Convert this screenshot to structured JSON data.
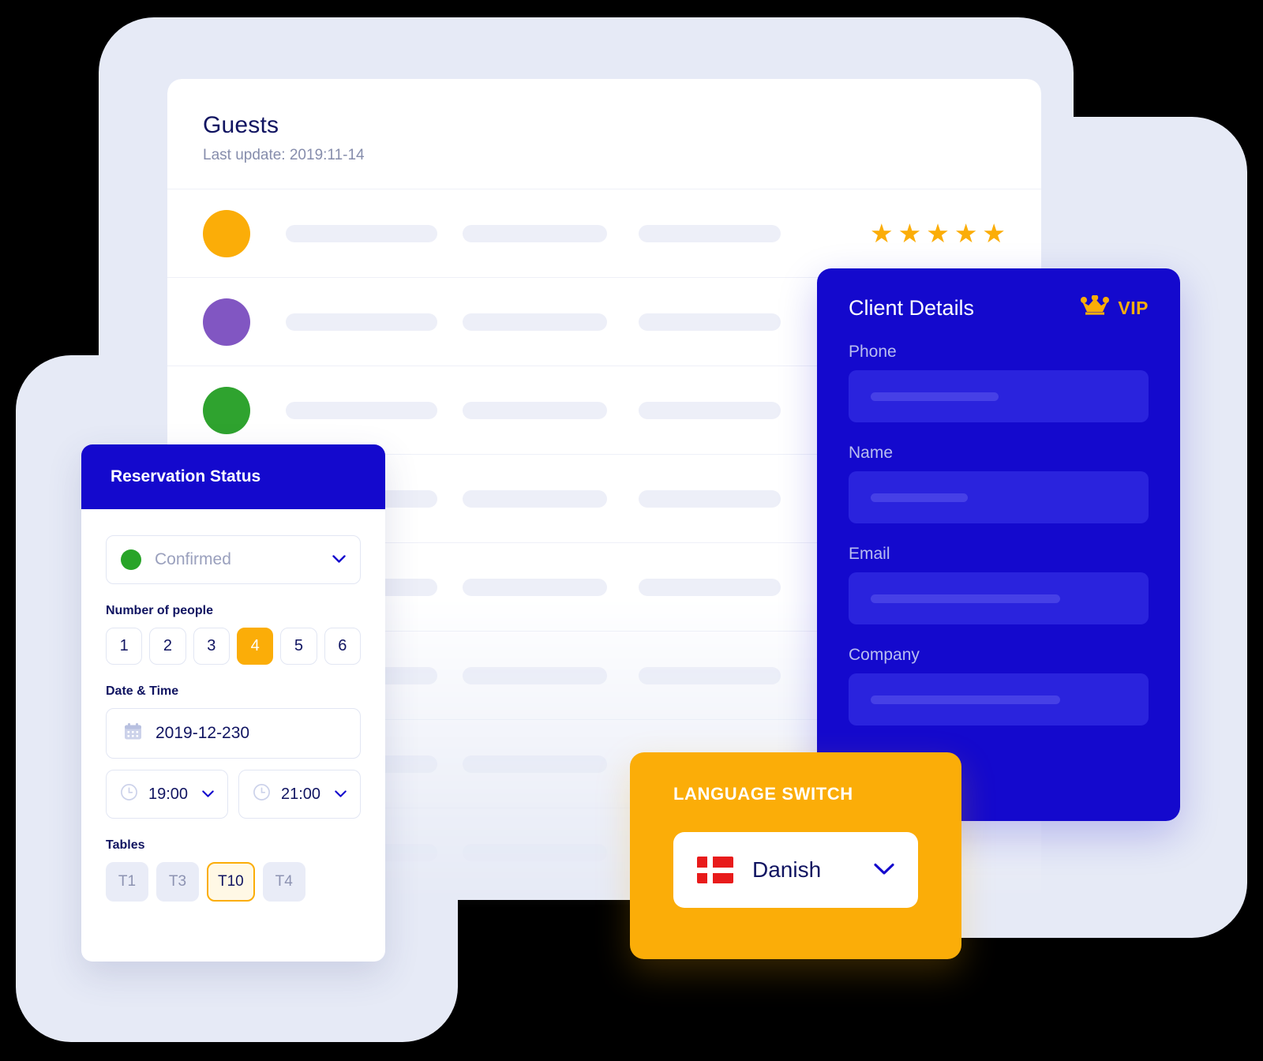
{
  "guests": {
    "title": "Guests",
    "subtitle": "Last update: 2019:11-14",
    "rows": [
      {
        "avatar_color": "#fbad08",
        "has_avatar": true,
        "stars": 5
      },
      {
        "avatar_color": "#8156c2",
        "has_avatar": true,
        "stars": 0
      },
      {
        "avatar_color": "#2fa32f",
        "has_avatar": true,
        "stars": 0
      },
      {
        "avatar_color": "",
        "has_avatar": false,
        "stars": 0
      },
      {
        "avatar_color": "",
        "has_avatar": false,
        "stars": 0
      },
      {
        "avatar_color": "",
        "has_avatar": false,
        "stars": 0
      },
      {
        "avatar_color": "",
        "has_avatar": false,
        "stars": 0
      },
      {
        "avatar_color": "",
        "has_avatar": false,
        "stars": 0
      }
    ],
    "star_glyph": "★"
  },
  "client_details": {
    "title": "Client Details",
    "vip_label": "VIP",
    "vip_icon": "crown-icon",
    "fields": [
      {
        "label": "Phone",
        "fill_width": "50%"
      },
      {
        "label": "Name",
        "fill_width": "38%"
      },
      {
        "label": "Email",
        "fill_width": "74%"
      },
      {
        "label": "Company",
        "fill_width": "74%"
      }
    ]
  },
  "reservation": {
    "title": "Reservation Status",
    "status": {
      "value": "Confirmed",
      "dot_color": "#28a428",
      "chevron": "⌄"
    },
    "people": {
      "label": "Number of people",
      "options": [
        "1",
        "2",
        "3",
        "4",
        "5",
        "6"
      ],
      "selected": "4"
    },
    "datetime": {
      "label": "Date & Time",
      "date_value": "2019-12-230",
      "date_icon": "calendar-icon",
      "time_from": "19:00",
      "time_to": "21:00",
      "time_icon": "clock-icon"
    },
    "tables": {
      "label": "Tables",
      "options": [
        "T1",
        "T3",
        "T10",
        "T4"
      ],
      "selected": "T10"
    }
  },
  "language_switch": {
    "title": "LANGUAGE SWITCH",
    "selected": "Danish",
    "flag": "danish-flag",
    "chevron": "⌄"
  },
  "colors": {
    "brand_blue": "#1409cd",
    "brand_orange": "#fbad08",
    "backdrop": "#e6eaf6",
    "text_dark": "#101461"
  }
}
